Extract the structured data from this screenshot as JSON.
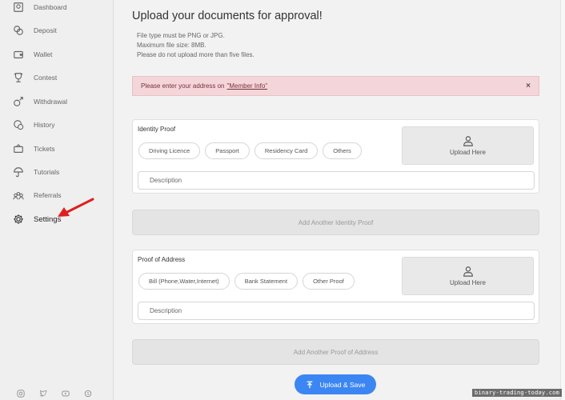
{
  "sidebar": {
    "items": [
      {
        "label": "Dashboard",
        "icon": "dashboard-icon"
      },
      {
        "label": "Deposit",
        "icon": "deposit-icon"
      },
      {
        "label": "Wallet",
        "icon": "wallet-icon"
      },
      {
        "label": "Contest",
        "icon": "trophy-icon"
      },
      {
        "label": "Withdrawal",
        "icon": "withdrawal-icon"
      },
      {
        "label": "History",
        "icon": "history-icon"
      },
      {
        "label": "Tickets",
        "icon": "tickets-icon"
      },
      {
        "label": "Tutorials",
        "icon": "umbrella-icon"
      },
      {
        "label": "Referrals",
        "icon": "referrals-icon"
      },
      {
        "label": "Settings",
        "icon": "gear-icon"
      }
    ],
    "active": "Settings",
    "social_icons": [
      "instagram-icon",
      "twitter-icon",
      "youtube-icon",
      "skype-icon"
    ]
  },
  "main": {
    "title": "Upload your documents for approval!",
    "rules": [
      "File type must be PNG or JPG.",
      "Maximum file size: 8MB.",
      "Please do not upload more than five files."
    ],
    "alert": {
      "text": "Please enter your address on",
      "link": "\"Member Info\"",
      "close": "×"
    },
    "identity": {
      "title": "Identity Proof",
      "options": [
        "Driving Licence",
        "Passport",
        "Residency Card",
        "Others"
      ],
      "upload_label": "Upload Here",
      "description_placeholder": "Description",
      "add_another": "Add Another Identity Proof"
    },
    "address": {
      "title": "Proof of Address",
      "options": [
        "Bill (Phone,Water,Internet)",
        "Bank Statement",
        "Other Proof"
      ],
      "upload_label": "Upload Here",
      "description_placeholder": "Description",
      "add_another": "Add Another Proof of Address"
    },
    "save_button": "Upload & Save"
  },
  "watermark": "binary-trading-today.com",
  "colors": {
    "accent": "#3b86f2",
    "alert_bg": "#f4d6da",
    "annotation_arrow": "#e01e1e"
  }
}
